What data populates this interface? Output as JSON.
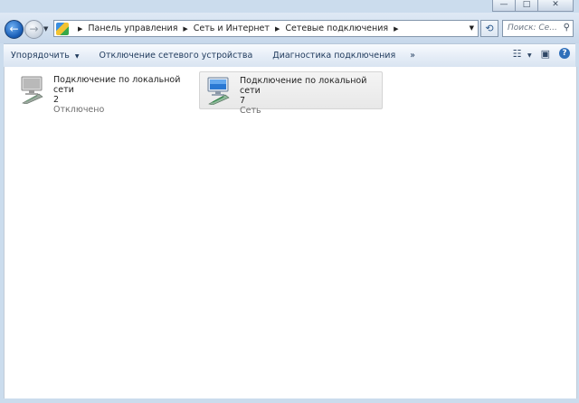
{
  "window": {
    "minimize_glyph": "—",
    "maximize_glyph": "□",
    "close_glyph": "✕"
  },
  "navigation": {
    "back_glyph": "←",
    "forward_glyph": "→",
    "dropdown_glyph": "▼",
    "breadcrumb": [
      "Панель управления",
      "Сеть и Интернет",
      "Сетевые подключения"
    ],
    "separator_glyph": "▶",
    "refresh_glyph": "⟲",
    "search_placeholder": "Поиск: Се...",
    "search_icon_glyph": "⚲"
  },
  "toolbar": {
    "organize_label": "Упорядочить",
    "dropdown_glyph": "▼",
    "disable_device_label": "Отключение сетевого устройства",
    "diagnose_label": "Диагностика подключения",
    "more_label": "»",
    "view_glyph": "☷",
    "preview_pane_glyph": "▣",
    "help_glyph": "?"
  },
  "connections": [
    {
      "name_line1": "Подключение по локальной сети",
      "name_line2": "2",
      "status": "Отключено",
      "icon": "network-adapter-disabled-icon"
    },
    {
      "name_line1": "Подключение по локальной сети",
      "name_line2": "7",
      "status": "Сеть",
      "icon": "network-adapter-connected-icon"
    }
  ],
  "colors": {
    "frame": "#cbdced",
    "content_bg": "#ffffff",
    "toolbar_text": "#1e395b",
    "status_text": "#6d6d6d"
  }
}
